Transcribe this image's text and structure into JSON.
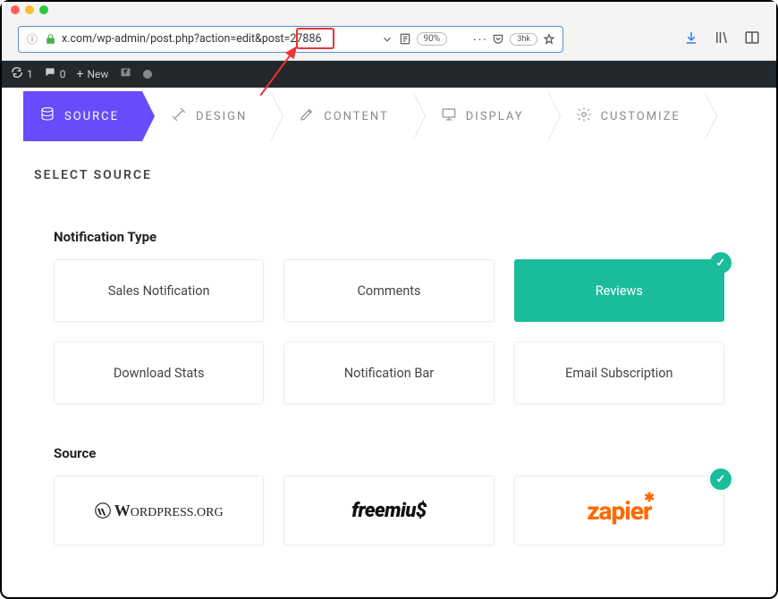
{
  "browser": {
    "url": "x.com/wp-admin/post.php?action=edit&post=27886",
    "highlighted_post_id": "27886",
    "zoom": "90%",
    "bookmark_tag": "3hk"
  },
  "wp_admin_bar": {
    "count1": "1",
    "count2": "0",
    "new_label": "New"
  },
  "steps": [
    {
      "label": "SOURCE",
      "icon": "database-icon",
      "active": true
    },
    {
      "label": "DESIGN",
      "icon": "wand-icon",
      "active": false
    },
    {
      "label": "CONTENT",
      "icon": "pencil-icon",
      "active": false
    },
    {
      "label": "DISPLAY",
      "icon": "monitor-icon",
      "active": false
    },
    {
      "label": "CUSTOMIZE",
      "icon": "gear-icon",
      "active": false
    }
  ],
  "section_title": "SELECT SOURCE",
  "notification_type": {
    "heading": "Notification Type",
    "items": [
      {
        "label": "Sales Notification",
        "selected": false
      },
      {
        "label": "Comments",
        "selected": false
      },
      {
        "label": "Reviews",
        "selected": true
      },
      {
        "label": "Download Stats",
        "selected": false
      },
      {
        "label": "Notification Bar",
        "selected": false
      },
      {
        "label": "Email Subscription",
        "selected": false
      }
    ]
  },
  "source": {
    "heading": "Source",
    "items": [
      {
        "label": "WordPress.org",
        "logo": "wordpress",
        "selected": false
      },
      {
        "label": "freemius",
        "logo": "freemius",
        "selected": false
      },
      {
        "label": "zapier",
        "logo": "zapier",
        "selected": true
      }
    ]
  }
}
